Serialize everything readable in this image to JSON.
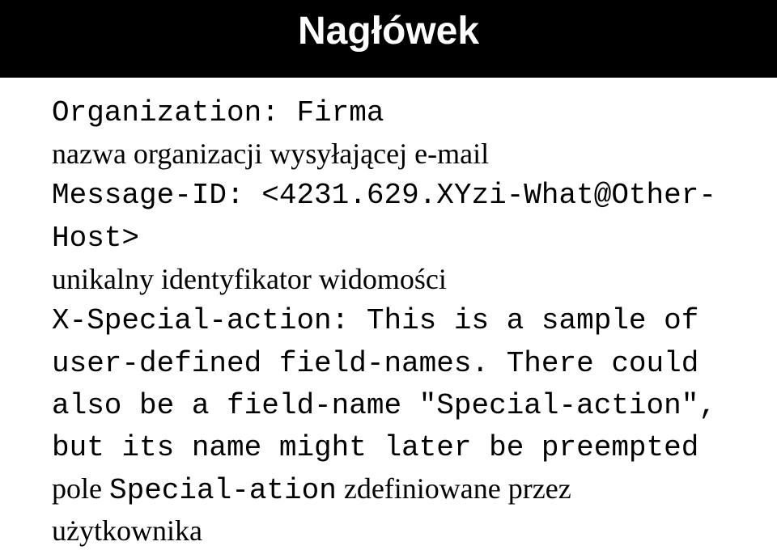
{
  "header": {
    "title": "Nagłówek"
  },
  "body": {
    "organization_line": "Organization: Firma",
    "organization_desc": "nazwa organizacji wysyłającej e-mail",
    "message_id_line": "Message-ID: <4231.629.XYzi-What@Other-Host>",
    "message_id_desc": "unikalny identyfikator widomości",
    "xspecial_line": "X-Special-action: This is a sample of user-defined field-names. There could also be a field-name \"Special-action\", but its name might later be preempted",
    "xspecial_desc_prefix": "pole ",
    "xspecial_desc_code": "Special-ation",
    "xspecial_desc_suffix": " zdefiniowane przez użytkownika"
  }
}
